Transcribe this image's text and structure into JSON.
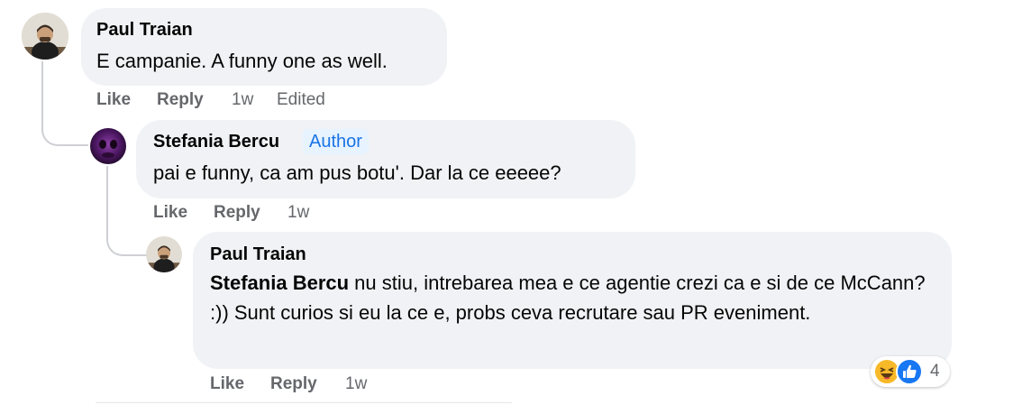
{
  "comments": [
    {
      "author": "Paul Traian",
      "text": "E campanie. A funny one as well.",
      "actions": {
        "like": "Like",
        "reply": "Reply"
      },
      "time": "1w",
      "edited": "Edited"
    },
    {
      "author": "Stefania Bercu",
      "badge": "Author",
      "text": "pai e funny, ca am pus botu'. Dar la ce eeeee?",
      "actions": {
        "like": "Like",
        "reply": "Reply"
      },
      "time": "1w"
    },
    {
      "author": "Paul Traian",
      "mention": "Stefania Bercu",
      "text": " nu stiu, intrebarea mea e ce agentie crezi ca e si de ce McCann? :)) Sunt curios si eu la ce e, probs ceva recrutare sau PR eveniment.",
      "actions": {
        "like": "Like",
        "reply": "Reply"
      },
      "time": "1w",
      "reactions": {
        "icons": [
          "haha-icon",
          "like-icon"
        ],
        "count": "4"
      }
    }
  ],
  "colors": {
    "bubble": "#f0f2f5",
    "meta": "#65676b",
    "author_badge_bg": "#e7f3ff",
    "author_badge_text": "#1b74e4",
    "like_blue": "#1877f2",
    "haha_yellow": "#f7b928"
  }
}
